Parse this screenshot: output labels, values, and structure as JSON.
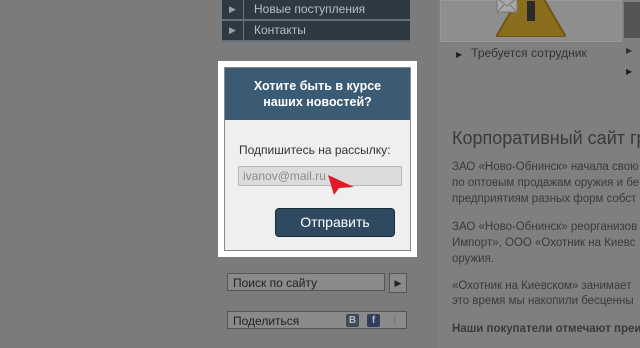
{
  "nav": {
    "items": [
      {
        "label": "Новые поступления"
      },
      {
        "label": "Контакты"
      }
    ]
  },
  "job": {
    "link": "Требуется сотрудник"
  },
  "main": {
    "heading": "Корпоративный сайт гру",
    "paragraphs": [
      "ЗАО «Ново-Обнинск» начала свою",
      "по оптовым продажам оружия и бе",
      "предприятиям разных форм собст",
      "ЗАО «Ново-Обнинск» реорганизов",
      "Импорт», ООО «Охотник на Киевс",
      "оружия.",
      "«Охотник на Киевском» занимает",
      "это время мы накопили бесценны",
      "Наши покупатели отмечают преим"
    ]
  },
  "sidebar": {
    "search_label": "Поиск по сайту",
    "share_label": "Поделиться"
  },
  "modal": {
    "title_line1": "Хотите быть в курсе",
    "title_line2": "наших новостей?",
    "subscribe_label": "Подпишитесь на рассылку:",
    "email_value": "ivanov@mail.ru",
    "submit_label": "Отправить"
  },
  "colors": {
    "modal_header": "#3b5a73",
    "submit_button": "#2f4a60",
    "cursor": "#e0192b"
  }
}
